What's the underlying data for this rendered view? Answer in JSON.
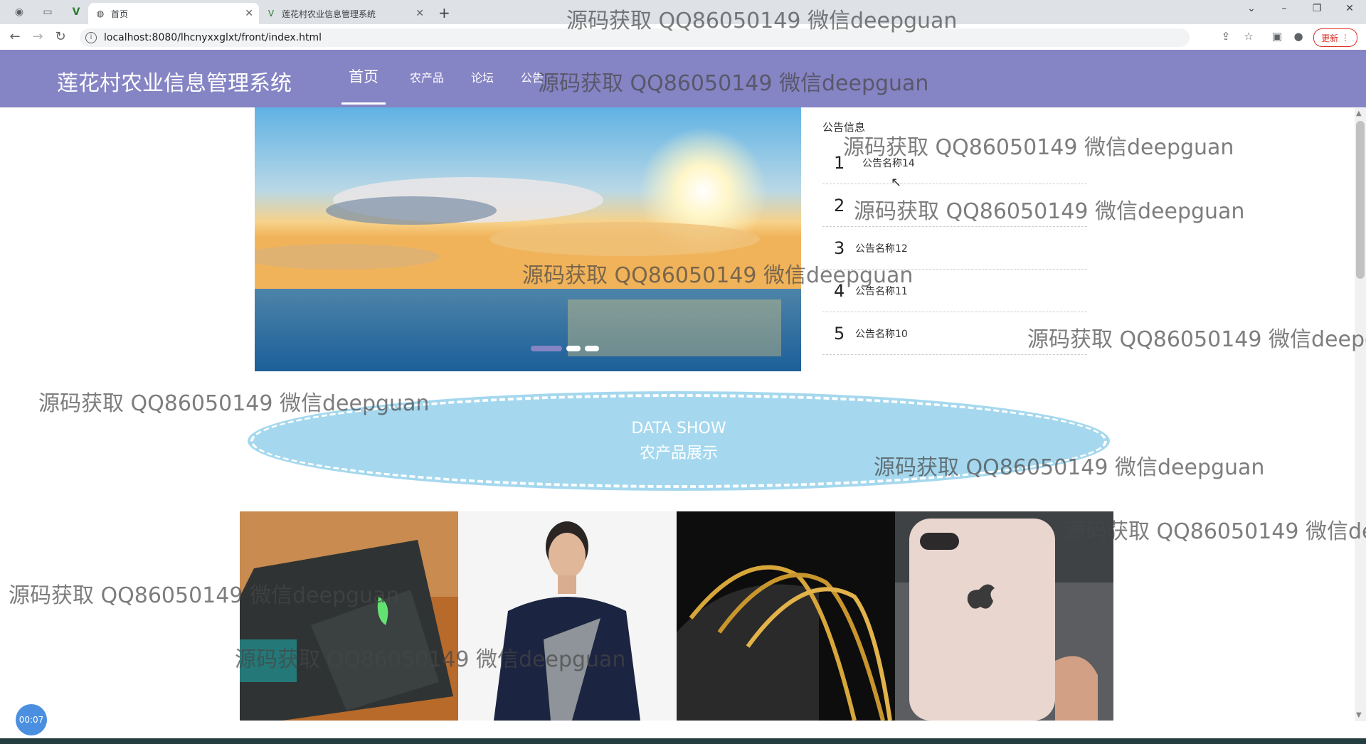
{
  "browser": {
    "tabs": [
      {
        "label": "首页",
        "active": true
      },
      {
        "label": "莲花村农业信息管理系统",
        "active": false
      }
    ],
    "url": "localhost:8080/lhcnyxxglxt/front/index.html",
    "update_label": "更新"
  },
  "site": {
    "title": "莲花村农业信息管理系统",
    "nav": [
      "首页",
      "农产品",
      "论坛",
      "公告"
    ]
  },
  "notice": {
    "title": "公告信息",
    "items": [
      {
        "num": "1",
        "text": "公告名称14"
      },
      {
        "num": "2",
        "text": ""
      },
      {
        "num": "3",
        "text": "公告名称12"
      },
      {
        "num": "4",
        "text": "公告名称11"
      },
      {
        "num": "5",
        "text": "公告名称10"
      }
    ]
  },
  "datashow": {
    "en": "DATA SHOW",
    "cn": "农产品展示"
  },
  "timer": "00:07",
  "watermark": "源码获取 QQ86050149 微信deepguan",
  "colors": {
    "header": "#8584c4",
    "banner": "#a5d8ee"
  }
}
